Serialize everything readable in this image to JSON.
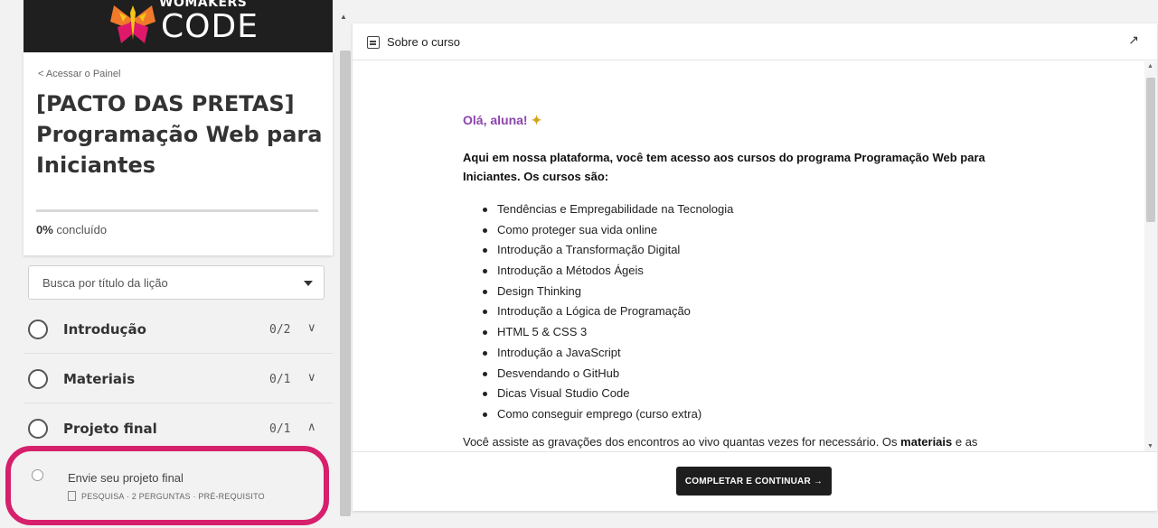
{
  "brand": {
    "top_text": "WOMAKERS",
    "bottom_text": "CODE",
    "logo_icon": "butterfly-logo-icon",
    "colors": {
      "background": "#1f1f1f",
      "logo_orange": "#f07a2a",
      "logo_yellow": "#f5c518",
      "logo_magenta": "#e0186c"
    }
  },
  "sidebar": {
    "back_link": "< Acessar o Painel",
    "course_title": "[PACTO DAS PRETAS] Programação Web para Iniciantes",
    "progress": {
      "value_percent": 0,
      "bold_text": "0%",
      "suffix_text": " concluído"
    },
    "search": {
      "placeholder": "Busca por título da lição"
    },
    "sections": [
      {
        "label": "Introdução",
        "count": "0/2",
        "expanded": false
      },
      {
        "label": "Materiais",
        "count": "0/1",
        "expanded": false
      },
      {
        "label": "Projeto final",
        "count": "0/1",
        "expanded": true
      }
    ],
    "lesson": {
      "title": "Envie seu projeto final",
      "meta": "PESQUISA · 2 PERGUNTAS · PRÉ-REQUISITO"
    },
    "highlight_color": "#d6206b"
  },
  "panel": {
    "header_title": "Sobre o curso",
    "greeting": "Olá, aluna!",
    "intro": "Aqui em nossa plataforma, você tem acesso aos cursos do programa Programação Web para Iniciantes. Os cursos são:",
    "courses": [
      "Tendências e Empregabilidade na Tecnologia",
      "Como proteger sua vida online",
      "Introdução a Transformação Digital",
      "Introdução a Métodos Ágeis",
      "Design Thinking",
      "Introdução a Lógica de Programação",
      "HTML 5 & CSS 3",
      "Introdução a JavaScript",
      "Desvendando o GitHub",
      "Dicas Visual Studio Code",
      "Como conseguir emprego (curso extra)"
    ],
    "footer_text_before": "Você assiste as gravações dos encontros ao vivo quantas vezes for necessário. Os ",
    "footer_text_bold": "materiais",
    "footer_text_after": " e as",
    "complete_button": "COMPLETAR E CONTINUAR →",
    "greeting_color": "#8e44ad"
  }
}
